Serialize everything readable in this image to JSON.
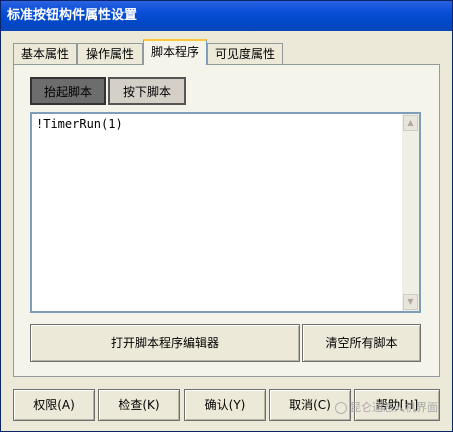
{
  "window": {
    "title": "标准按钮构件属性设置"
  },
  "tabs": [
    {
      "label": "基本属性"
    },
    {
      "label": "操作属性"
    },
    {
      "label": "脚本程序"
    },
    {
      "label": "可见度属性"
    }
  ],
  "active_tab": "脚本程序",
  "subtabs": [
    {
      "label": "抬起脚本"
    },
    {
      "label": "按下脚本"
    }
  ],
  "editor": {
    "content": "!TimerRun(1)"
  },
  "actions": {
    "open_editor_label": "打开脚本程序编辑器",
    "clear_all_label": "清空所有脚本"
  },
  "footer_buttons": [
    {
      "label": "权限(A)"
    },
    {
      "label": "检查(K)"
    },
    {
      "label": "确认(Y)"
    },
    {
      "label": "取消(C)"
    },
    {
      "label": "帮助[H]"
    }
  ],
  "watermark": {
    "text": "昆仑通态人机界面"
  }
}
